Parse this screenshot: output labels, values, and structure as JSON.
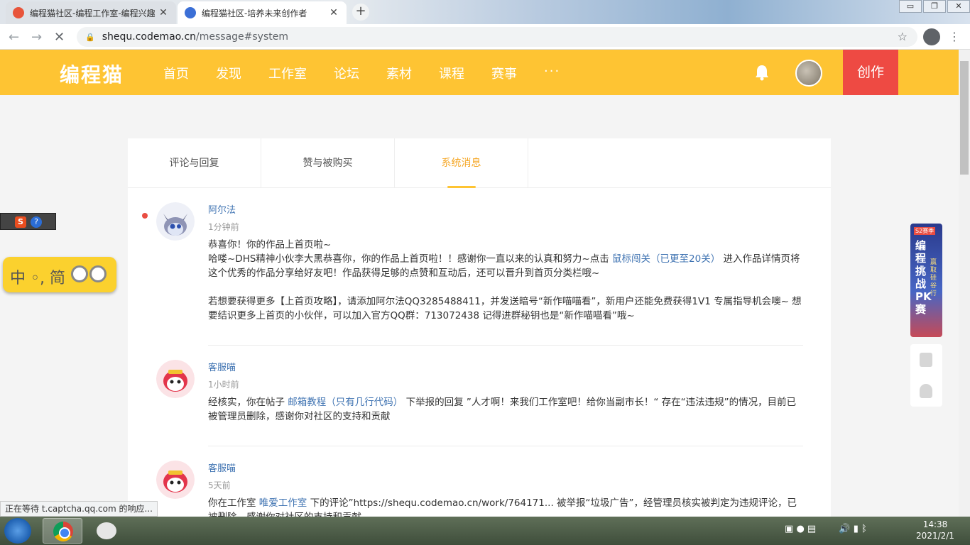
{
  "browser": {
    "tabs": [
      {
        "title": "编程猫社区-编程工作室-编程兴趣",
        "active": false
      },
      {
        "title": "编程猫社区-培养未来创作者",
        "active": true
      }
    ],
    "new_tab_symbol": "+",
    "close_symbol": "✕",
    "url_host": "shequ.codemao.cn",
    "url_path": "/message#system",
    "window_controls": [
      "▭",
      "❐",
      "✕"
    ]
  },
  "site": {
    "logo": "编程猫",
    "nav": [
      "首页",
      "发现",
      "工作室",
      "论坛",
      "素材",
      "课程",
      "赛事"
    ],
    "more": "···",
    "create_label": "创作",
    "accent": "#fec433",
    "create_color": "#ee4a43"
  },
  "message_tabs": [
    {
      "label": "评论与回复",
      "active": false
    },
    {
      "label": "赞与被购买",
      "active": false
    },
    {
      "label": "系统消息",
      "active": true
    }
  ],
  "messages": [
    {
      "sender": "阿尔法",
      "time": "1分钟前",
      "unread": true,
      "line1": "恭喜你！你的作品上首页啦~",
      "line2_pre": "哈喽~DHS精神小伙李大黑恭喜你，你的作品上首页啦！！感谢你一直以来的认真和努力~点击",
      "line2_link": "鼠标闯关（已更至20关）",
      "line2_post": "进入作品详情页将这个优秀的作品分享给好友吧！作品获得足够的点赞和互动后，还可以晋升到首页分类栏哦~",
      "line3": "若想要获得更多【上首页攻略】，请添加阿尔法QQ3285488411，并发送暗号“新作喵喵看”，新用户还能免费获得1V1 专属指导机会噢~ 想要结识更多上首页的小伙伴，可以加入官方QQ群：713072438 记得进群秘钥也是“新作喵喵看”哦~"
    },
    {
      "sender": "客服喵",
      "time": "1小时前",
      "unread": false,
      "body_pre": "经核实，你在帖子",
      "body_link": "邮箱教程（只有几行代码）",
      "body_post": "下举报的回复 ”人才啊！来我们工作室吧！给你当副市长！“ 存在“违法违规”的情况，目前已被管理员删除，感谢你对社区的支持和贡献"
    },
    {
      "sender": "客服喵",
      "time": "5天前",
      "unread": false,
      "body_pre": "你在工作室",
      "body_link": "唯爱工作室",
      "body_post": "下的评论”https://shequ.codemao.cn/work/764171... 被举报“垃圾广告”，经管理员核实被判定为违规评论，已被删除，感谢你对社区的支持和贡献"
    }
  ],
  "ime": {
    "pill_text": "中 ◦, 简",
    "bar_s": "S",
    "bar_q": "?"
  },
  "ad": {
    "badge": "S2赛季",
    "title": "编程挑战PK赛",
    "sub": "赢取硅谷行"
  },
  "status_popup": "正在等待 t.captcha.qq.com 的响应...",
  "taskbar": {
    "time": "14:38",
    "date": "2021/2/1"
  }
}
